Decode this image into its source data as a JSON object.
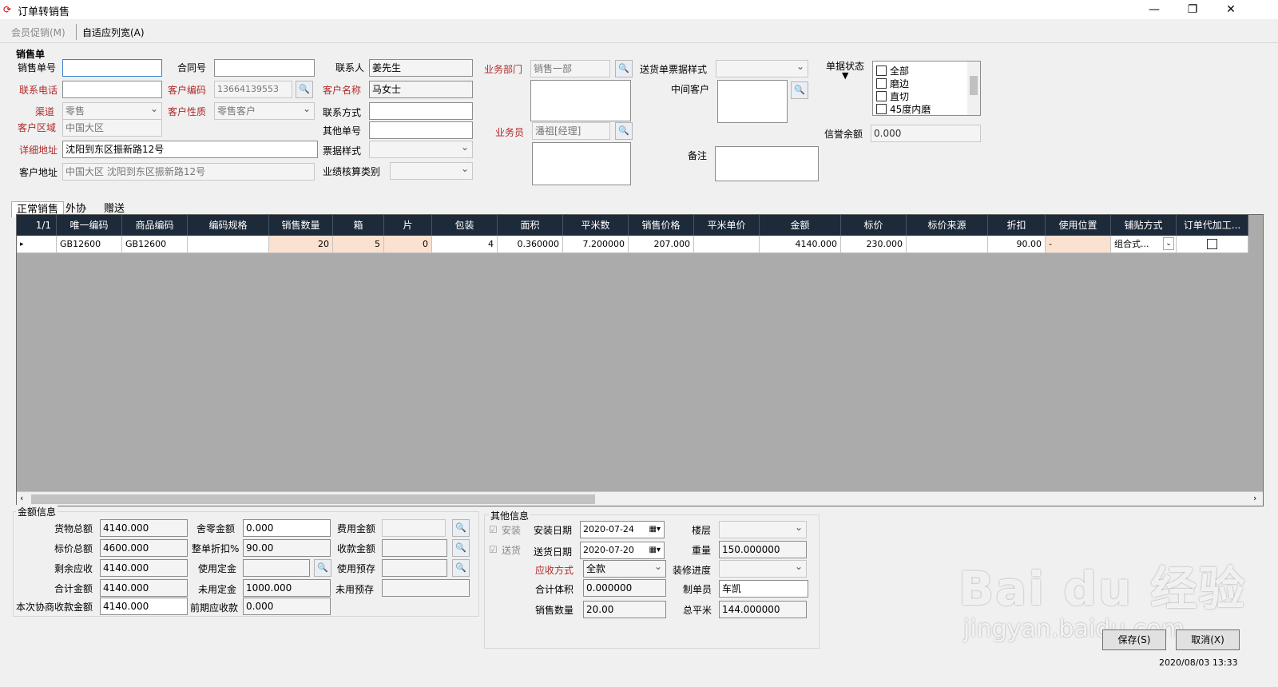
{
  "window": {
    "title": "订单转销售",
    "minimize": "—",
    "maximize": "❐",
    "close": "✕"
  },
  "toolbar": {
    "promo": "会员促销(M)",
    "autofit": "自适应列宽(A)"
  },
  "form": {
    "section": "销售单",
    "order_no_label": "销售单号",
    "order_no": "",
    "contract_label": "合同号",
    "contract": "",
    "contact_label": "联系人",
    "contact": "姜先生",
    "phone_label": "联系电话",
    "phone": "",
    "cust_code_label": "客户编码",
    "cust_code": "13664139553",
    "cust_name_label": "客户名称",
    "cust_name": "马女士",
    "channel_label": "渠道",
    "channel": "零售",
    "cust_type_label": "客户性质",
    "cust_type": "零售客户",
    "contact_method_label": "联系方式",
    "contact_method": "",
    "region_label": "客户区域",
    "region": "中国大区",
    "other_no_label": "其他单号",
    "other_no": "",
    "address_label": "详细地址",
    "address": "沈阳到东区振新路12号",
    "ticket_style_label": "票据样式",
    "ticket_style": "",
    "cust_address_label": "客户地址",
    "cust_address": "中国大区 沈阳到东区振新路12号",
    "perf_label": "业绩核算类别",
    "perf": "",
    "dept_label": "业务部门",
    "dept": "销售一部",
    "salesman_label": "业务员",
    "salesman": "潘祖[经理]",
    "delivery_style_label": "送货单票据样式",
    "delivery_style": "",
    "middle_cust_label": "中间客户",
    "remark_label": "备注",
    "status_label": "单据状态",
    "status_arrow": "▼",
    "status_items": [
      "全部",
      "磨边",
      "直切",
      "45度内磨"
    ],
    "credit_label": "信誉余额",
    "credit": "0.000"
  },
  "tabs": [
    "正常销售",
    "外协",
    "赠送"
  ],
  "grid": {
    "counter": "1/1",
    "headers": [
      "唯一编码",
      "商品编码",
      "编码规格",
      "销售数量",
      "箱",
      "片",
      "包装",
      "面积",
      "平米数",
      "销售价格",
      "平米单价",
      "金额",
      "标价",
      "标价来源",
      "折扣",
      "使用位置",
      "铺贴方式",
      "订单代加工..."
    ],
    "row": [
      "GB12600",
      "GB12600",
      "",
      "20",
      "5",
      "0",
      "4",
      "0.360000",
      "7.200000",
      "207.000",
      "",
      "4140.000",
      "230.000",
      "",
      "90.00",
      "-",
      "组合式...",
      ""
    ],
    "row_marker": "▸"
  },
  "amount": {
    "section": "金额信息",
    "goods_total_label": "货物总额",
    "goods_total": "4140.000",
    "rounding_label": "舍零金额",
    "rounding": "0.000",
    "fee_label": "费用金额",
    "fee": "",
    "list_total_label": "标价总额",
    "list_total": "4600.000",
    "discount_label": "整单折扣%",
    "discount": "90.00",
    "receipt_label": "收款金额",
    "receipt": "",
    "remaining_label": "剩余应收",
    "remaining": "4140.000",
    "deposit_label": "使用定金",
    "deposit": "",
    "prepay_label": "使用预存",
    "prepay": "",
    "sum_label": "合计金额",
    "sum": "4140.000",
    "unused_deposit_label": "未用定金",
    "unused_deposit": "1000.000",
    "unused_prepay_label": "未用预存",
    "unused_prepay": "",
    "negotiated_label": "本次协商收款金额",
    "negotiated": "4140.000",
    "prev_due_label": "前期应收款",
    "prev_due": "0.000"
  },
  "other": {
    "section": "其他信息",
    "install_label": "安装",
    "deliver_label": "送货",
    "install_date_label": "安装日期",
    "install_date": "2020-07-24",
    "deliver_date_label": "送货日期",
    "deliver_date": "2020-07-20",
    "collect_label": "应收方式",
    "collect": "全款",
    "volume_label": "合计体积",
    "volume": "0.000000",
    "qty_label": "销售数量",
    "qty": "20.00",
    "floor_label": "楼层",
    "floor": "",
    "weight_label": "重量",
    "weight": "150.000000",
    "decor_label": "装修进度",
    "decor": "",
    "maker_label": "制单员",
    "maker": "车凯",
    "area_label": "总平米",
    "area": "144.000000"
  },
  "buttons": {
    "save": "保存(S)",
    "cancel": "取消(X)"
  },
  "status_bar": {
    "datetime": "2020/08/03 13:33"
  },
  "watermark": {
    "brand": "Bai du 经验",
    "url": "jingyan.baidu.com"
  }
}
